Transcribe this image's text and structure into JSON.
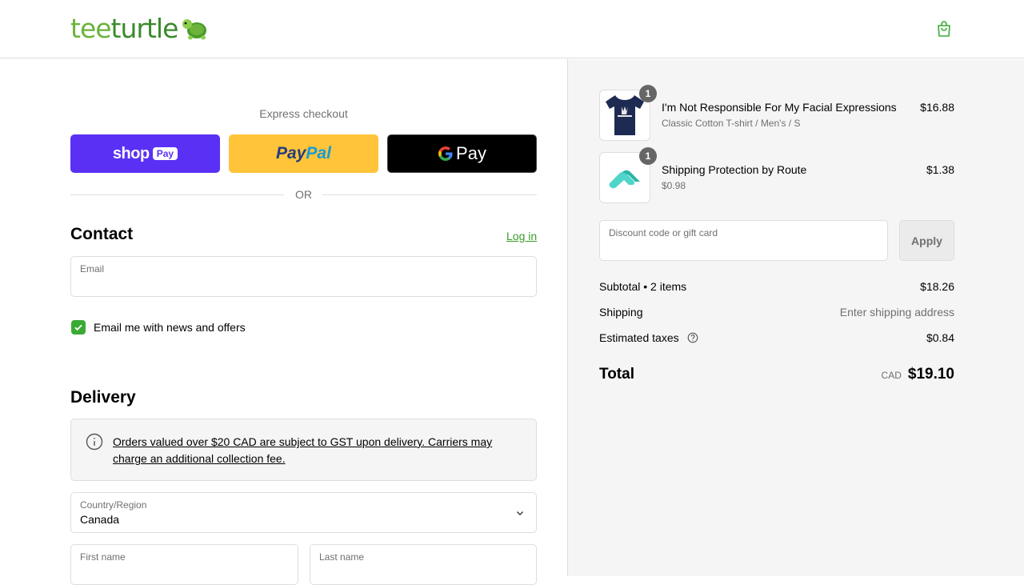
{
  "header": {
    "logo_tee": "tee",
    "logo_turtle": "turtle",
    "logo_icon": "turtle-mascot-icon",
    "cart_icon": "shopping-bag-icon"
  },
  "colors": {
    "brand_green": "#3aaa35",
    "shop_pay": "#5a31f4",
    "paypal": "#ffc439",
    "gpay": "#000000"
  },
  "express": {
    "title": "Express checkout",
    "shop_pay_label": "shop",
    "shop_pay_tag": "Pay",
    "paypal_pay": "Pay",
    "paypal_pal": "Pal",
    "gpay_label": "Pay",
    "or_text": "OR"
  },
  "contact": {
    "heading": "Contact",
    "login_link": "Log in",
    "email_label": "Email",
    "email_value": "",
    "newsletter_label": "Email me with news and offers",
    "newsletter_checked": true
  },
  "delivery": {
    "heading": "Delivery",
    "notice": "Orders valued over $20 CAD are subject to GST upon delivery. Carriers may charge an additional collection fee.",
    "country_label": "Country/Region",
    "country_value": "Canada",
    "first_name_label": "First name",
    "last_name_label": "Last name"
  },
  "order": {
    "items": [
      {
        "title": "I'm Not Responsible For My Facial Expressions",
        "subtitle": "Classic Cotton T-shirt / Men's / S",
        "price": "$16.88",
        "qty": "1"
      },
      {
        "title": "Shipping Protection by Route",
        "subtitle": "$0.98",
        "price": "$1.38",
        "qty": "1"
      }
    ],
    "discount_placeholder": "Discount code or gift card",
    "apply_label": "Apply",
    "subtotal_label": "Subtotal • 2 items",
    "subtotal_value": "$18.26",
    "shipping_label": "Shipping",
    "shipping_value": "Enter shipping address",
    "taxes_label": "Estimated taxes",
    "taxes_value": "$0.84",
    "total_label": "Total",
    "currency": "CAD",
    "total_value": "$19.10"
  }
}
